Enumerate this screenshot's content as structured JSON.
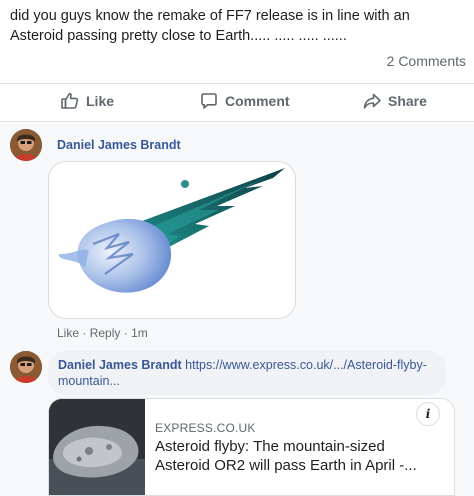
{
  "post": {
    "text": "did you guys know the remake of FF7 release is in line with an Asteroid passing pretty close to Earth..... ..... ..... ......",
    "comments_count": "2 Comments"
  },
  "actions": {
    "like": "Like",
    "comment": "Comment",
    "share": "Share",
    "like_icon": "thumbs-up-icon",
    "comment_icon": "speech-bubble-icon",
    "share_icon": "share-arrow-icon"
  },
  "comments": [
    {
      "author": "Daniel James Brandt",
      "image_alt": "Final Fantasy VII meteor logo",
      "actions": {
        "like": "Like",
        "sep1": "·",
        "reply": "Reply",
        "sep2": "·",
        "time": "1m"
      }
    },
    {
      "author": "Daniel James Brandt",
      "url_text": "https://www.express.co.uk/.../Asteroid-flyby-mountain...",
      "link_preview": {
        "domain": "EXPRESS.CO.UK",
        "title": "Asteroid flyby: The mountain-sized Asteroid OR2 will pass Earth in April -...",
        "info_label": "i"
      }
    }
  ],
  "colors": {
    "link_blue": "#385898",
    "meteor_teal": "#1f9a93",
    "meteor_blue": "#6a8fd4",
    "muted_text": "#606770"
  }
}
